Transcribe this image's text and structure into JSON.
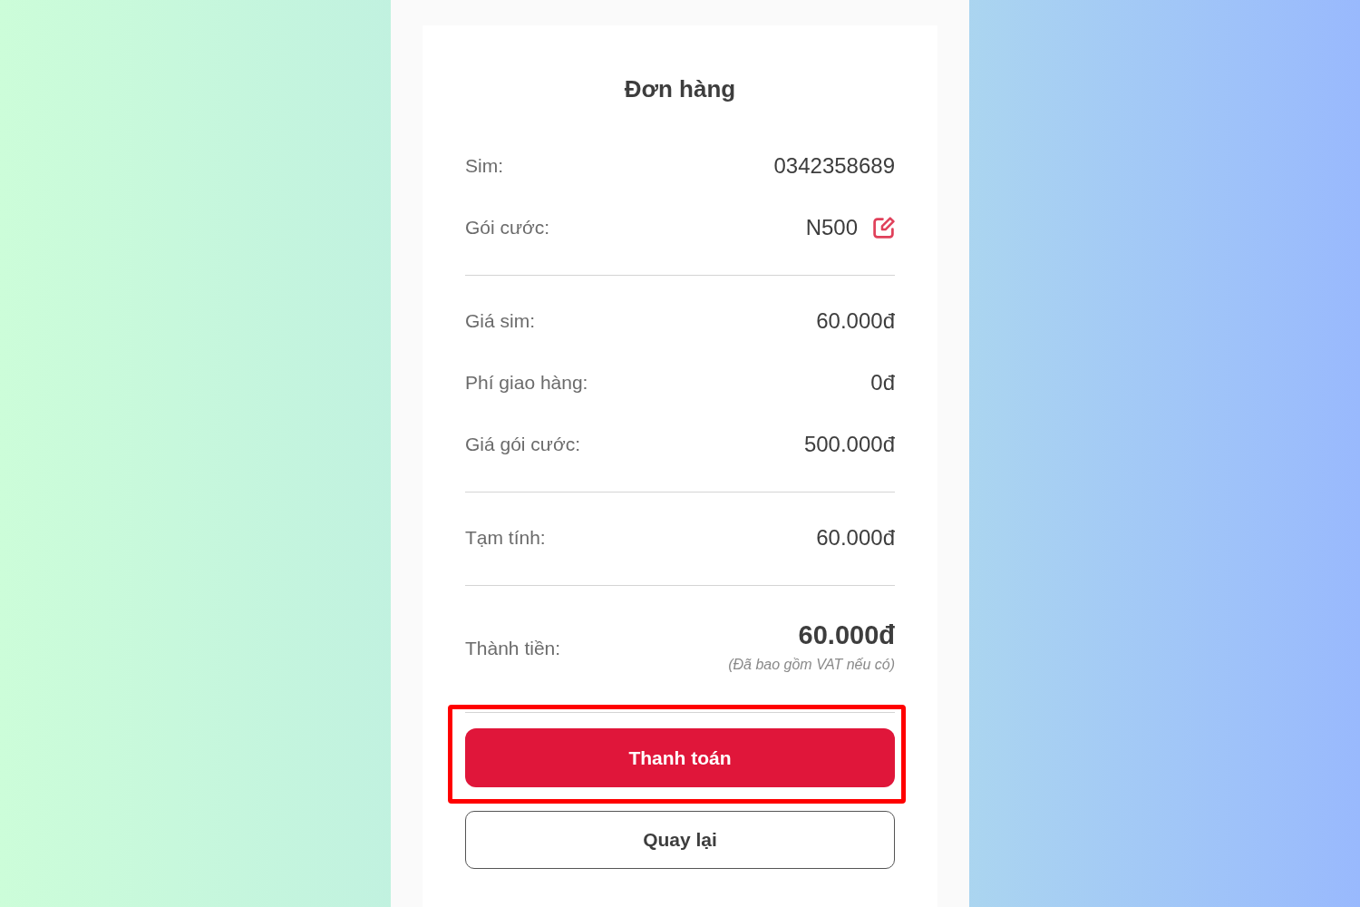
{
  "title": "Đơn hàng",
  "sections": [
    {
      "rows": [
        {
          "label": "Sim:",
          "value": "0342358689",
          "editable": false
        },
        {
          "label": "Gói cước:",
          "value": "N500",
          "editable": true
        }
      ]
    },
    {
      "rows": [
        {
          "label": "Giá sim:",
          "value": "60.000đ",
          "editable": false
        },
        {
          "label": "Phí giao hàng:",
          "value": "0đ",
          "editable": false
        },
        {
          "label": "Giá gói cước:",
          "value": "500.000đ",
          "editable": false
        }
      ]
    },
    {
      "rows": [
        {
          "label": "Tạm tính:",
          "value": "60.000đ",
          "editable": false
        }
      ]
    }
  ],
  "total": {
    "label": "Thành tiền:",
    "value": "60.000đ",
    "note": "(Đã bao gồm VAT nếu có)"
  },
  "buttons": [
    {
      "label": "Thanh toán",
      "kind": "primary",
      "highlighted": true
    },
    {
      "label": "Quay lại",
      "kind": "secondary",
      "highlighted": false
    }
  ]
}
